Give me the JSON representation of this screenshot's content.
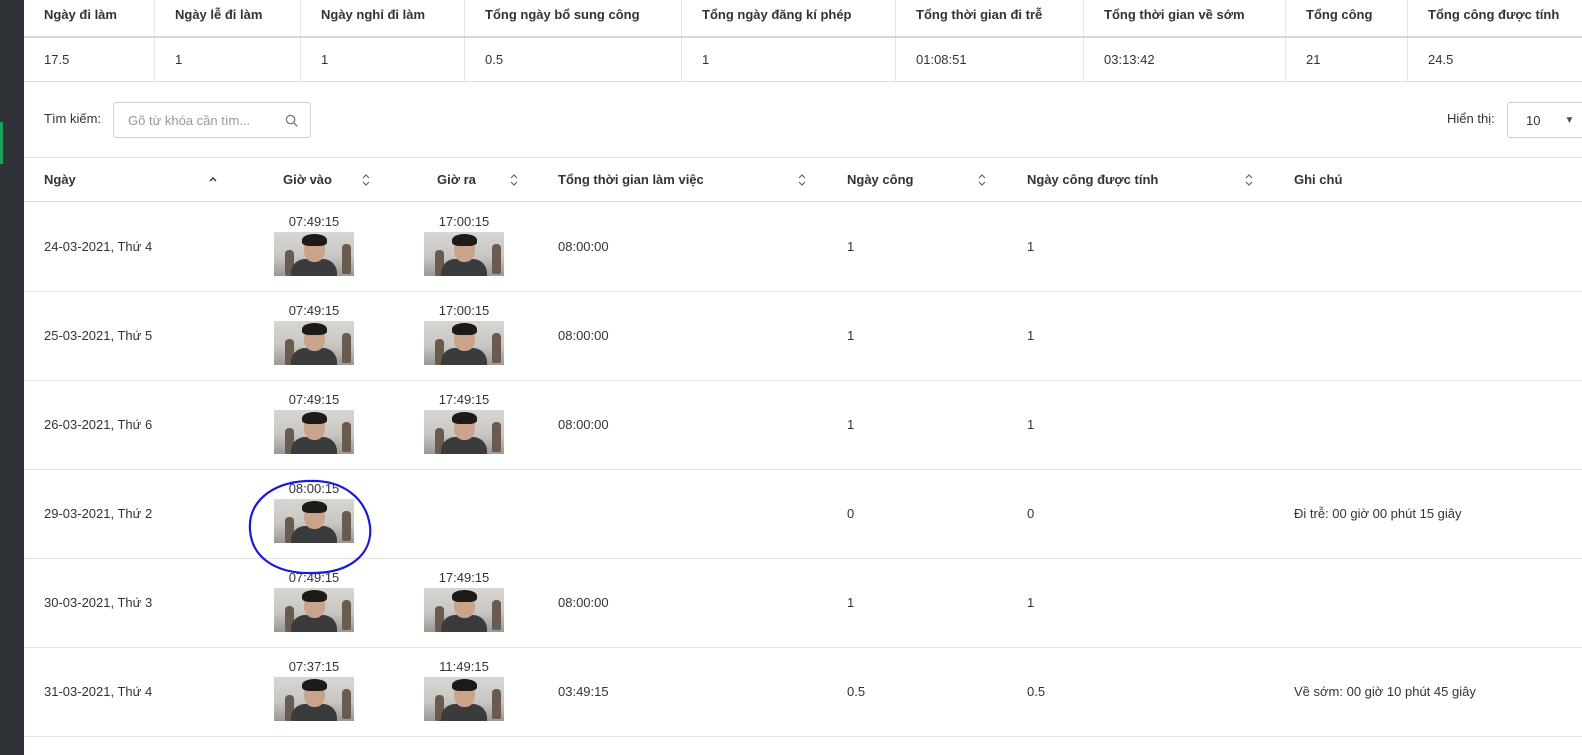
{
  "summary": {
    "headers": [
      "Ngày đi làm",
      "Ngày lễ đi làm",
      "Ngày nghỉ đi làm",
      "Tổng ngày bổ sung công",
      "Tổng ngày đăng kí phép",
      "Tổng thời gian đi trễ",
      "Tổng thời gian về sớm",
      "Tổng công",
      "Tổng công được tính"
    ],
    "values": [
      "17.5",
      "1",
      "1",
      "0.5",
      "1",
      "01:08:51",
      "03:13:42",
      "21",
      "24.5"
    ]
  },
  "search": {
    "label": "Tìm kiếm:",
    "placeholder": "Gõ từ khóa cần tìm..."
  },
  "page_size": {
    "label": "Hiển thị:",
    "value": "10"
  },
  "table": {
    "headers": {
      "date": "Ngày",
      "time_in": "Giờ vào",
      "time_out": "Giờ ra",
      "total_time": "Tổng thời gian làm việc",
      "workday": "Ngày công",
      "counted_workday": "Ngày công được tính",
      "note": "Ghi chú"
    },
    "rows": [
      {
        "date": "24-03-2021, Thứ 4",
        "time_in": "07:49:15",
        "time_out": "17:00:15",
        "total_time": "08:00:00",
        "workday": "1",
        "counted_workday": "1",
        "note": ""
      },
      {
        "date": "25-03-2021, Thứ 5",
        "time_in": "07:49:15",
        "time_out": "17:00:15",
        "total_time": "08:00:00",
        "workday": "1",
        "counted_workday": "1",
        "note": ""
      },
      {
        "date": "26-03-2021, Thứ 6",
        "time_in": "07:49:15",
        "time_out": "17:49:15",
        "total_time": "08:00:00",
        "workday": "1",
        "counted_workday": "1",
        "note": ""
      },
      {
        "date": "29-03-2021, Thứ 2",
        "time_in": "08:00:15",
        "time_out": "",
        "total_time": "",
        "workday": "0",
        "counted_workday": "0",
        "note": "Đi trễ: 00 giờ 00 phút 15 giây"
      },
      {
        "date": "30-03-2021, Thứ 3",
        "time_in": "07:49:15",
        "time_out": "17:49:15",
        "total_time": "08:00:00",
        "workday": "1",
        "counted_workday": "1",
        "note": ""
      },
      {
        "date": "31-03-2021, Thứ 4",
        "time_in": "07:37:15",
        "time_out": "11:49:15",
        "total_time": "03:49:15",
        "workday": "0.5",
        "counted_workday": "0.5",
        "note": "Về sớm: 00 giờ 10 phút 45 giây"
      }
    ]
  },
  "colors": {
    "annotation": "#1a1ad6",
    "sidebar": "#2f3338",
    "sidebar_accent": "#1aa35a"
  },
  "icons": {
    "search": "search-icon",
    "sort": "sort-icon",
    "dropdown": "chevron-down-icon"
  }
}
